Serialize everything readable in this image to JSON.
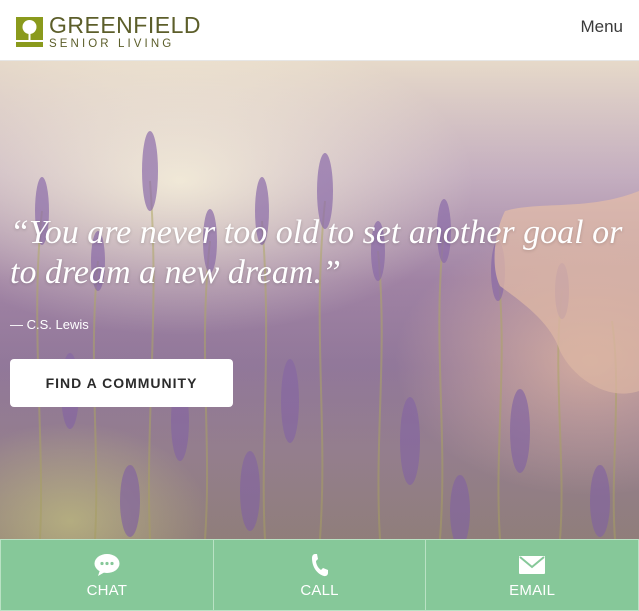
{
  "header": {
    "logo": {
      "name_line1": "GREENFIELD",
      "name_line2": "SENIOR LIVING",
      "mark_icon": "tree-square-icon",
      "brand_color": "#8a9a1c"
    },
    "menu_label": "Menu"
  },
  "hero": {
    "background": "lavender-field-with-hand",
    "quote": "“You are never too old to set another goal or to dream a new dream.”",
    "author": "— C.S. Lewis",
    "cta_label": "FIND A COMMUNITY"
  },
  "footer": {
    "background_color": "#86c899",
    "buttons": [
      {
        "label": "CHAT",
        "icon": "chat-bubble-icon"
      },
      {
        "label": "CALL",
        "icon": "phone-icon"
      },
      {
        "label": "EMAIL",
        "icon": "envelope-icon"
      }
    ]
  }
}
